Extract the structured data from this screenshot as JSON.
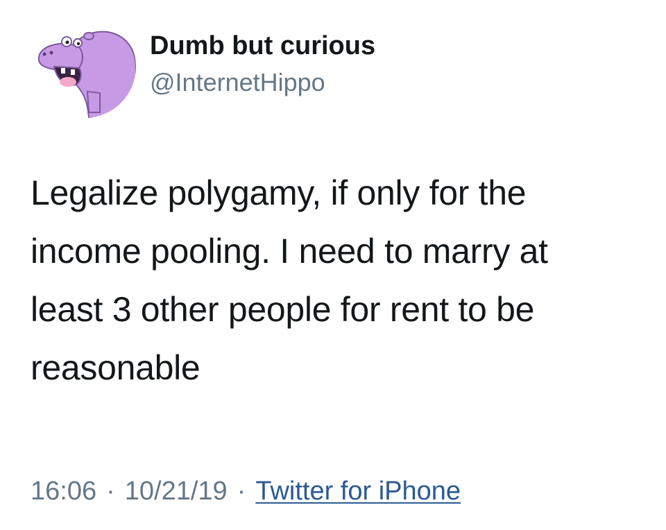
{
  "tweet": {
    "author": {
      "display_name": "Dumb but curious",
      "handle": "@InternetHippo",
      "avatar_icon": "hippo-avatar-icon",
      "avatar_color": "#c79ae6"
    },
    "text_lines": [
      "Legalize polygamy, if only for the",
      "income pooling. I need to marry at",
      "least 3 other people for rent to be",
      "reasonable"
    ],
    "time": "16:06",
    "separator": "·",
    "date": "10/21/19",
    "source": "Twitter for iPhone",
    "colors": {
      "text": "#14171a",
      "secondary": "#657786",
      "link": "#2b5a93"
    }
  }
}
